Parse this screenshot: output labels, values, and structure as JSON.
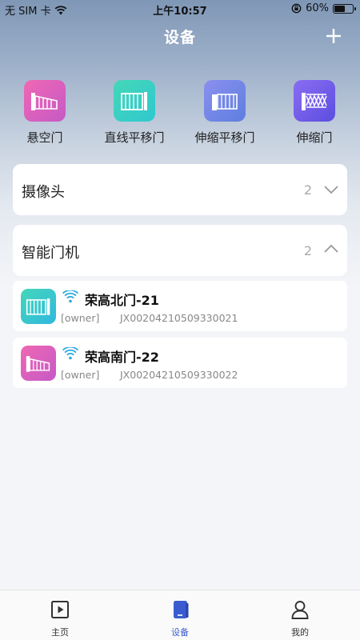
{
  "status_bar": {
    "carrier": "无 SIM 卡",
    "time": "上午10:57",
    "battery": "60%",
    "battery_level": 0.6
  },
  "nav": {
    "title": "设备",
    "add_icon": "plus-icon"
  },
  "categories": [
    {
      "label": "悬空门",
      "icon": "cantilever-gate-icon",
      "color_from": "#f067b3",
      "color_to": "#c55ac6"
    },
    {
      "label": "直线平移门",
      "icon": "sliding-gate-icon",
      "color_from": "#45d7b8",
      "color_to": "#2fc8cf"
    },
    {
      "label": "伸缩平移门",
      "icon": "telescopic-sliding-gate-icon",
      "color_from": "#8b8fee",
      "color_to": "#5d7fe0"
    },
    {
      "label": "伸缩门",
      "icon": "retractable-gate-icon",
      "color_from": "#8a6df2",
      "color_to": "#5c4ee0"
    }
  ],
  "sections": {
    "camera": {
      "title": "摄像头",
      "count": "2",
      "expanded": false
    },
    "gate_machine": {
      "title": "智能门机",
      "count": "2",
      "expanded": true
    }
  },
  "devices": [
    {
      "name": "荣高北门-21",
      "owner": "[owner]",
      "serial": "JX00204210509330021",
      "icon": "sliding-gate-icon",
      "color_from": "#45d7b8",
      "color_to": "#2fb8e0"
    },
    {
      "name": "荣高南门-22",
      "owner": "[owner]",
      "serial": "JX00204210509330022",
      "icon": "cantilever-gate-icon",
      "color_from": "#f067b3",
      "color_to": "#c55ac6"
    }
  ],
  "tabbar": {
    "items": [
      {
        "label": "主页",
        "icon": "play-square-icon"
      },
      {
        "label": "设备",
        "icon": "device-icon"
      },
      {
        "label": "我的",
        "icon": "user-icon"
      }
    ],
    "active_color": "#3a5bd0"
  }
}
